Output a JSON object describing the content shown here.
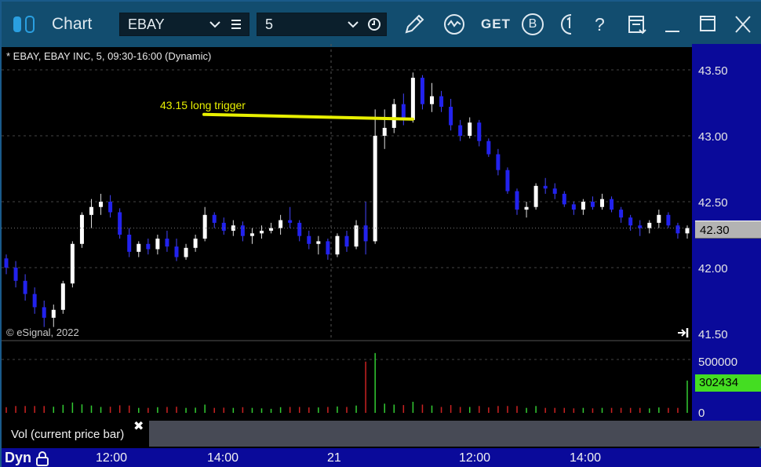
{
  "window": {
    "title": "Chart",
    "symbol": "EBAY",
    "interval": "5",
    "toolbar_glyphs": {
      "get": "GET",
      "b": "B",
      "help": "?"
    }
  },
  "chart": {
    "description": "* EBAY, EBAY INC, 5, 09:30-16:00 (Dynamic)",
    "copyright": "© eSignal, 2022",
    "annotation": "43.15 long trigger",
    "current_price": "42.30",
    "current_volume": "302434",
    "price_axis_labels": [
      "43.50",
      "43.00",
      "42.50",
      "42.00",
      "41.50"
    ],
    "volume_axis_labels": [
      "500000",
      "0"
    ],
    "volume_study_label": "Vol (current price bar)",
    "time_axis": {
      "mode": "Dyn",
      "labels": [
        "12:00",
        "14:00",
        "21",
        "12:00",
        "14:00"
      ]
    },
    "colors": {
      "up_bar": "#ffffff",
      "down_bar": "#2222ee",
      "annotation": "#e8f000",
      "vol_up": "#33cc33",
      "vol_down": "#cc2222"
    }
  },
  "chart_data": {
    "type": "candlestick",
    "symbol": "EBAY",
    "interval": "5",
    "session": "09:30-16:00",
    "ylim": [
      41.5,
      43.5
    ],
    "annotation_level": 43.15,
    "candles": [
      [
        42.07,
        42.1,
        41.95,
        42.0
      ],
      [
        42.0,
        42.05,
        41.85,
        41.9
      ],
      [
        41.9,
        41.95,
        41.75,
        41.8
      ],
      [
        41.8,
        41.85,
        41.65,
        41.7
      ],
      [
        41.7,
        41.75,
        41.55,
        41.62
      ],
      [
        41.62,
        41.72,
        41.55,
        41.68
      ],
      [
        41.68,
        41.9,
        41.65,
        41.88
      ],
      [
        41.88,
        42.2,
        41.85,
        42.18
      ],
      [
        42.18,
        42.42,
        42.15,
        42.4
      ],
      [
        42.4,
        42.52,
        42.3,
        42.46
      ],
      [
        42.46,
        42.56,
        42.4,
        42.5
      ],
      [
        42.5,
        42.55,
        42.38,
        42.42
      ],
      [
        42.42,
        42.45,
        42.22,
        42.25
      ],
      [
        42.25,
        42.3,
        42.08,
        42.12
      ],
      [
        42.12,
        42.2,
        42.08,
        42.18
      ],
      [
        42.18,
        42.22,
        42.1,
        42.14
      ],
      [
        42.14,
        42.25,
        42.1,
        42.22
      ],
      [
        42.22,
        42.28,
        42.12,
        42.16
      ],
      [
        42.16,
        42.22,
        42.05,
        42.08
      ],
      [
        42.08,
        42.18,
        42.06,
        42.15
      ],
      [
        42.15,
        42.25,
        42.12,
        42.22
      ],
      [
        42.22,
        42.46,
        42.2,
        42.4
      ],
      [
        42.4,
        42.42,
        42.3,
        42.34
      ],
      [
        42.34,
        42.38,
        42.25,
        42.28
      ],
      [
        42.28,
        42.36,
        42.24,
        42.32
      ],
      [
        42.32,
        42.35,
        42.2,
        42.24
      ],
      [
        42.24,
        42.3,
        42.18,
        42.26
      ],
      [
        42.26,
        42.32,
        42.22,
        42.28
      ],
      [
        42.28,
        42.34,
        42.26,
        42.3
      ],
      [
        42.3,
        42.4,
        42.25,
        42.36
      ],
      [
        42.36,
        42.46,
        42.3,
        42.34
      ],
      [
        42.34,
        42.36,
        42.2,
        42.24
      ],
      [
        42.24,
        42.28,
        42.14,
        42.18
      ],
      [
        42.18,
        42.24,
        42.1,
        42.2
      ],
      [
        42.2,
        42.22,
        42.06,
        42.1
      ],
      [
        42.1,
        42.26,
        42.08,
        42.24
      ],
      [
        42.24,
        42.28,
        42.12,
        42.16
      ],
      [
        42.16,
        42.36,
        42.14,
        42.32
      ],
      [
        42.32,
        42.5,
        42.1,
        42.2
      ],
      [
        42.2,
        43.2,
        42.18,
        43.0
      ],
      [
        43.0,
        43.2,
        42.9,
        43.06
      ],
      [
        43.06,
        43.28,
        43.02,
        43.24
      ],
      [
        43.24,
        43.32,
        43.08,
        43.12
      ],
      [
        43.12,
        43.48,
        43.1,
        43.44
      ],
      [
        43.44,
        43.46,
        43.2,
        43.24
      ],
      [
        43.24,
        43.4,
        43.18,
        43.3
      ],
      [
        43.3,
        43.34,
        43.18,
        43.22
      ],
      [
        43.22,
        43.28,
        43.04,
        43.08
      ],
      [
        43.08,
        43.12,
        42.96,
        43.0
      ],
      [
        43.0,
        43.14,
        42.98,
        43.1
      ],
      [
        43.1,
        43.12,
        42.92,
        42.96
      ],
      [
        42.96,
        42.98,
        42.84,
        42.86
      ],
      [
        42.86,
        42.9,
        42.7,
        42.74
      ],
      [
        42.74,
        42.76,
        42.56,
        42.58
      ],
      [
        42.58,
        42.6,
        42.4,
        42.44
      ],
      [
        42.44,
        42.5,
        42.38,
        42.46
      ],
      [
        42.46,
        42.64,
        42.44,
        42.62
      ],
      [
        42.62,
        42.68,
        42.56,
        42.6
      ],
      [
        42.6,
        42.64,
        42.52,
        42.56
      ],
      [
        42.56,
        42.58,
        42.46,
        42.48
      ],
      [
        42.48,
        42.5,
        42.4,
        42.44
      ],
      [
        42.44,
        42.52,
        42.4,
        42.5
      ],
      [
        42.5,
        42.54,
        42.44,
        42.46
      ],
      [
        42.46,
        42.56,
        42.44,
        42.52
      ],
      [
        42.52,
        42.54,
        42.42,
        42.44
      ],
      [
        42.44,
        42.46,
        42.34,
        42.38
      ],
      [
        42.38,
        42.4,
        42.28,
        42.32
      ],
      [
        42.32,
        42.36,
        42.24,
        42.3
      ],
      [
        42.3,
        42.36,
        42.26,
        42.34
      ],
      [
        42.34,
        42.44,
        42.3,
        42.4
      ],
      [
        42.4,
        42.42,
        42.3,
        42.32
      ],
      [
        42.32,
        42.34,
        42.22,
        42.26
      ],
      [
        42.26,
        42.32,
        42.22,
        42.3
      ]
    ],
    "volume_ylim": [
      0,
      500000
    ],
    "current_volume": 302434
  }
}
